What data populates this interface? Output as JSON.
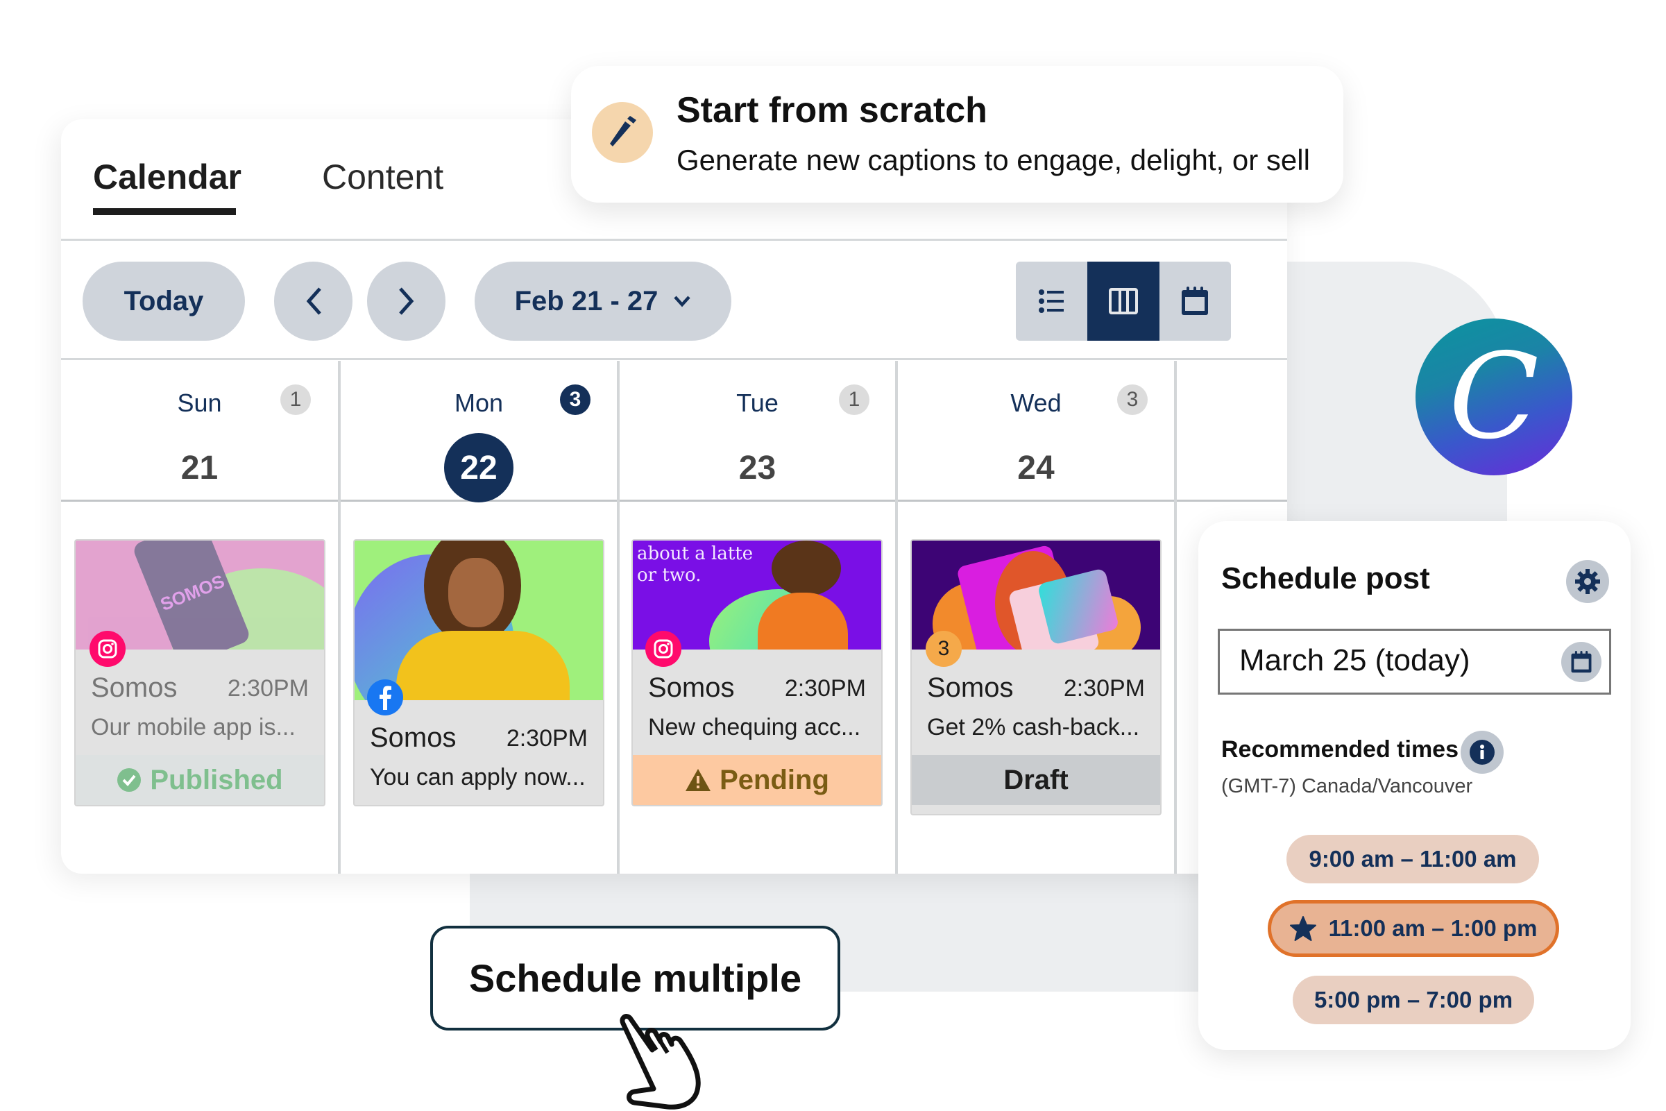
{
  "tabs": [
    {
      "label": "Calendar",
      "active": true
    },
    {
      "label": "Content",
      "active": false
    }
  ],
  "toolbar": {
    "today_label": "Today",
    "prev_icon": "chevron-left-icon",
    "next_icon": "chevron-right-icon",
    "date_range": "Feb 21 - 27",
    "views": [
      {
        "name": "list-view",
        "icon": "list-icon",
        "active": false
      },
      {
        "name": "week-view",
        "icon": "columns-icon",
        "active": true
      },
      {
        "name": "month-view",
        "icon": "calendar-icon",
        "active": false
      }
    ]
  },
  "days": [
    {
      "dow": "Sun",
      "date": "21",
      "count": "1",
      "today": false
    },
    {
      "dow": "Mon",
      "date": "22",
      "count": "3",
      "today": true
    },
    {
      "dow": "Tue",
      "date": "23",
      "count": "1",
      "today": false
    },
    {
      "dow": "Wed",
      "date": "24",
      "count": "3",
      "today": false
    }
  ],
  "posts": [
    {
      "network": "instagram",
      "name": "Somos",
      "time": "2:30PM",
      "caption": "Our mobile app is...",
      "status": "Published",
      "image_text": "SOMOS"
    },
    {
      "network": "facebook",
      "name": "Somos",
      "time": "2:30PM",
      "caption": "You can apply now...",
      "status": ""
    },
    {
      "network": "instagram",
      "name": "Somos",
      "time": "2:30PM",
      "caption": "New chequing acc...",
      "status": "Pending",
      "image_text": "about a latte or two."
    },
    {
      "network": "count",
      "badge": "3",
      "name": "Somos",
      "time": "2:30PM",
      "caption": "Get 2% cash-back...",
      "status": "Draft"
    }
  ],
  "status_colors": {
    "published_bg": "#dde1e1",
    "published_fg": "#7fbf8e",
    "pending_bg": "#fdc9a1",
    "pending_fg": "#7a5c14",
    "draft_bg": "#c9cccf",
    "draft_fg": "#1d1d1d"
  },
  "scratch": {
    "title": "Start from scratch",
    "subtitle": "Generate new captions to engage, delight, or sell"
  },
  "canva_logo": "C",
  "schedule": {
    "title": "Schedule post",
    "date_value": "March 25 (today)",
    "recommended_label": "Recommended times",
    "timezone": "(GMT-7) Canada/Vancouver",
    "times": [
      {
        "label": "9:00 am – 11:00 am",
        "best": false
      },
      {
        "label": "11:00 am – 1:00 pm",
        "best": true
      },
      {
        "label": "5:00 pm – 7:00 pm",
        "best": false
      }
    ]
  },
  "schedule_multiple": "Schedule multiple",
  "colors": {
    "navy": "#143059",
    "accent_orange": "#e0722a"
  }
}
